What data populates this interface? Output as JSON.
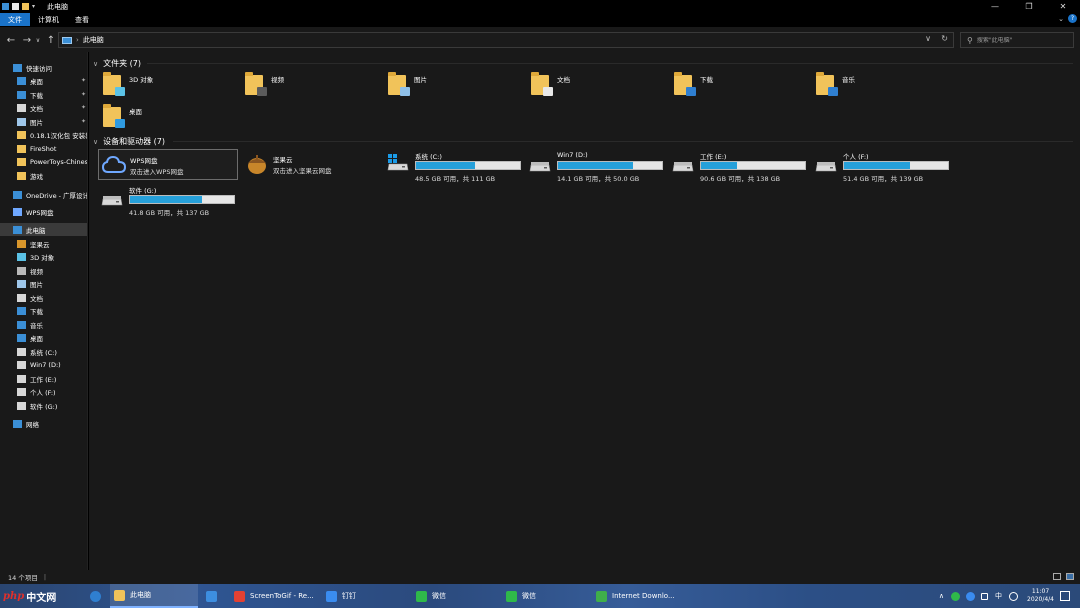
{
  "window": {
    "title": "此电脑",
    "controls": {
      "minimize": "—",
      "maximize": "❐",
      "close": "✕"
    }
  },
  "ribbon": {
    "tabs": [
      {
        "label": "文件",
        "active": true
      },
      {
        "label": "计算机",
        "active": false
      },
      {
        "label": "查看",
        "active": false
      }
    ],
    "expand_glyph": "⌄",
    "help_glyph": "?"
  },
  "address": {
    "path": [
      "此电脑"
    ],
    "search_placeholder": "搜索\"此电脑\""
  },
  "nav": {
    "items": [
      {
        "label": "快速访问",
        "icon": "star-icon",
        "color": "#3b8fd6",
        "pinned": false
      },
      {
        "label": "桌面",
        "icon": "desktop-icon",
        "color": "#3b8fd6",
        "pinned": true
      },
      {
        "label": "下载",
        "icon": "download-icon",
        "color": "#3b8fd6",
        "pinned": true
      },
      {
        "label": "文档",
        "icon": "document-icon",
        "color": "#d7d7d7",
        "pinned": true
      },
      {
        "label": "图片",
        "icon": "picture-icon",
        "color": "#9fc7ea",
        "pinned": true
      },
      {
        "label": "0.18.1汉化包 安装教",
        "icon": "folder-icon",
        "color": "#f1c35a",
        "pinned": false
      },
      {
        "label": "FireShot",
        "icon": "folder-icon",
        "color": "#f1c35a",
        "pinned": false
      },
      {
        "label": "PowerToys-Chines",
        "icon": "folder-icon",
        "color": "#f1c35a",
        "pinned": false
      },
      {
        "label": "游戏",
        "icon": "folder-icon",
        "color": "#f1c35a",
        "pinned": false
      },
      {
        "label": "OneDrive - 广厚设计",
        "icon": "onedrive-icon",
        "color": "#3b8fd6",
        "pinned": false
      },
      {
        "label": "WPS网盘",
        "icon": "wps-cloud-icon",
        "color": "#6fa8ff",
        "pinned": false
      },
      {
        "label": "此电脑",
        "icon": "this-pc-icon",
        "color": "#3b8fd6",
        "pinned": false,
        "selected": true
      },
      {
        "label": "坚果云",
        "icon": "nutstore-icon",
        "color": "#d8962b",
        "pinned": false
      },
      {
        "label": "3D 对象",
        "icon": "3d-objects-icon",
        "color": "#5bc2e6",
        "pinned": false
      },
      {
        "label": "视频",
        "icon": "video-icon",
        "color": "#b9b9b9",
        "pinned": false
      },
      {
        "label": "图片",
        "icon": "picture-icon",
        "color": "#9fc7ea",
        "pinned": false
      },
      {
        "label": "文档",
        "icon": "document-icon",
        "color": "#d7d7d7",
        "pinned": false
      },
      {
        "label": "下载",
        "icon": "download-icon",
        "color": "#3b8fd6",
        "pinned": false
      },
      {
        "label": "音乐",
        "icon": "music-icon",
        "color": "#3b8fd6",
        "pinned": false
      },
      {
        "label": "桌面",
        "icon": "desktop-icon",
        "color": "#3b8fd6",
        "pinned": false
      },
      {
        "label": "系统 (C:)",
        "icon": "drive-icon",
        "color": "#d7d7d7",
        "pinned": false
      },
      {
        "label": "Win7 (D:)",
        "icon": "drive-icon",
        "color": "#d7d7d7",
        "pinned": false
      },
      {
        "label": "工作 (E:)",
        "icon": "drive-icon",
        "color": "#d7d7d7",
        "pinned": false
      },
      {
        "label": "个人 (F:)",
        "icon": "drive-icon",
        "color": "#d7d7d7",
        "pinned": false
      },
      {
        "label": "软件 (G:)",
        "icon": "drive-icon",
        "color": "#d7d7d7",
        "pinned": false
      },
      {
        "label": "网络",
        "icon": "network-icon",
        "color": "#3b8fd6",
        "pinned": false
      }
    ]
  },
  "folders": {
    "header": "文件夹 (7)",
    "items": [
      {
        "name": "3D 对象",
        "icon": "3d-objects-folder-icon",
        "badge": "#5bc2e6"
      },
      {
        "name": "视频",
        "icon": "video-folder-icon",
        "badge": "#5b5b5b"
      },
      {
        "name": "图片",
        "icon": "picture-folder-icon",
        "badge": "#8fc0e8"
      },
      {
        "name": "文档",
        "icon": "document-folder-icon",
        "badge": "#e8e8e8"
      },
      {
        "name": "下载",
        "icon": "download-folder-icon",
        "badge": "#2f7fd0"
      },
      {
        "name": "音乐",
        "icon": "music-folder-icon",
        "badge": "#2f7fd0"
      },
      {
        "name": "桌面",
        "icon": "desktop-folder-icon",
        "badge": "#2f9ae0"
      }
    ]
  },
  "devices": {
    "header": "设备和驱动器 (7)",
    "clouds": [
      {
        "name": "WPS网盘",
        "desc": "双击进入WPS网盘",
        "icon": "wps-cloud-icon",
        "selected": true
      },
      {
        "name": "坚果云",
        "desc": "双击进入坚果云网盘",
        "icon": "nutstore-icon",
        "selected": false
      }
    ],
    "drives": [
      {
        "name": "系统 (C:)",
        "free": "48.5 GB 可用，共 111 GB",
        "used_fraction": 0.563,
        "system": true
      },
      {
        "name": "Win7 (D:)",
        "free": "14.1 GB 可用，共 50.0 GB",
        "used_fraction": 0.718,
        "system": false
      },
      {
        "name": "工作 (E:)",
        "free": "90.6 GB 可用，共 138 GB",
        "used_fraction": 0.343,
        "system": false
      },
      {
        "name": "个人 (F:)",
        "free": "51.4 GB 可用，共 139 GB",
        "used_fraction": 0.63,
        "system": false
      },
      {
        "name": "软件 (G:)",
        "free": "41.8 GB 可用，共 137 GB",
        "used_fraction": 0.695,
        "system": false
      }
    ]
  },
  "status": {
    "count": "14 个项目"
  },
  "taskbar": {
    "watermark_php": "php",
    "watermark_cn": "中文网",
    "apps": [
      {
        "label": "此电脑",
        "icon": "explorer-icon",
        "color": "#f1c35a",
        "active": true
      },
      {
        "label": "",
        "icon": "mail-icon",
        "color": "#3d8ee0",
        "active": false
      },
      {
        "label": "ScreenToGif - Re...",
        "icon": "chrome-icon",
        "color": "#e34133",
        "active": false
      },
      {
        "label": "钉钉",
        "icon": "dingtalk-icon",
        "color": "#3a8cf0",
        "active": false
      },
      {
        "label": "微信",
        "icon": "wechat-icon",
        "color": "#2fb94a",
        "active": false
      },
      {
        "label": "微信",
        "icon": "wechat-icon",
        "color": "#2fb94a",
        "active": false
      },
      {
        "label": "Internet Downlo...",
        "icon": "idm-icon",
        "color": "#3fae4a",
        "active": false
      }
    ],
    "ime": "中",
    "time": "11:07",
    "date": "2020/4/4"
  }
}
